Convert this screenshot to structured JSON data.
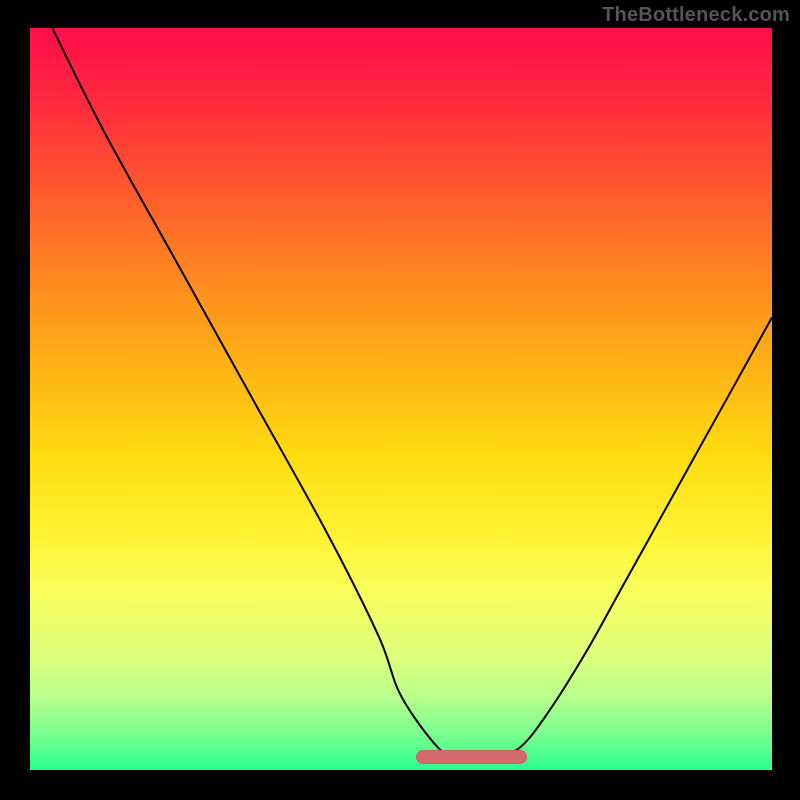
{
  "watermark": "TheBottleneck.com",
  "colors": {
    "frame_bg": "#000000",
    "curve": "#000000",
    "valley_marker": "#d36a6a",
    "gradient_stops": [
      "#ff0d4c",
      "#ff2a3d",
      "#ff5a2d",
      "#ff8a1f",
      "#ffb315",
      "#ffdd10",
      "#fff232",
      "#f8ff5c",
      "#e1ff7a",
      "#b9ff8a",
      "#7cff8f",
      "#2bff8f"
    ]
  },
  "chart_data": {
    "type": "line",
    "title": "",
    "xlabel": "",
    "ylabel": "",
    "xlim": [
      0,
      100
    ],
    "ylim": [
      0,
      100
    ],
    "grid": false,
    "legend": false,
    "note": "No axis ticks or numeric labels are rendered in the image; values are estimated from pixel positions. y=0 is the bottom (green) edge, y=100 is the top (red) edge.",
    "series": [
      {
        "name": "bottleneck-curve",
        "x": [
          3,
          10,
          20,
          30,
          40,
          47,
          50,
          55,
          58,
          62,
          66,
          70,
          75,
          80,
          85,
          90,
          95,
          100
        ],
        "y": [
          100,
          86,
          68,
          50,
          32,
          18,
          10,
          3,
          1.5,
          1.5,
          3,
          8,
          16,
          25,
          34,
          43,
          52,
          61
        ]
      }
    ],
    "valley_marker": {
      "x_start": 52,
      "x_end": 67,
      "y": 1.5
    }
  }
}
